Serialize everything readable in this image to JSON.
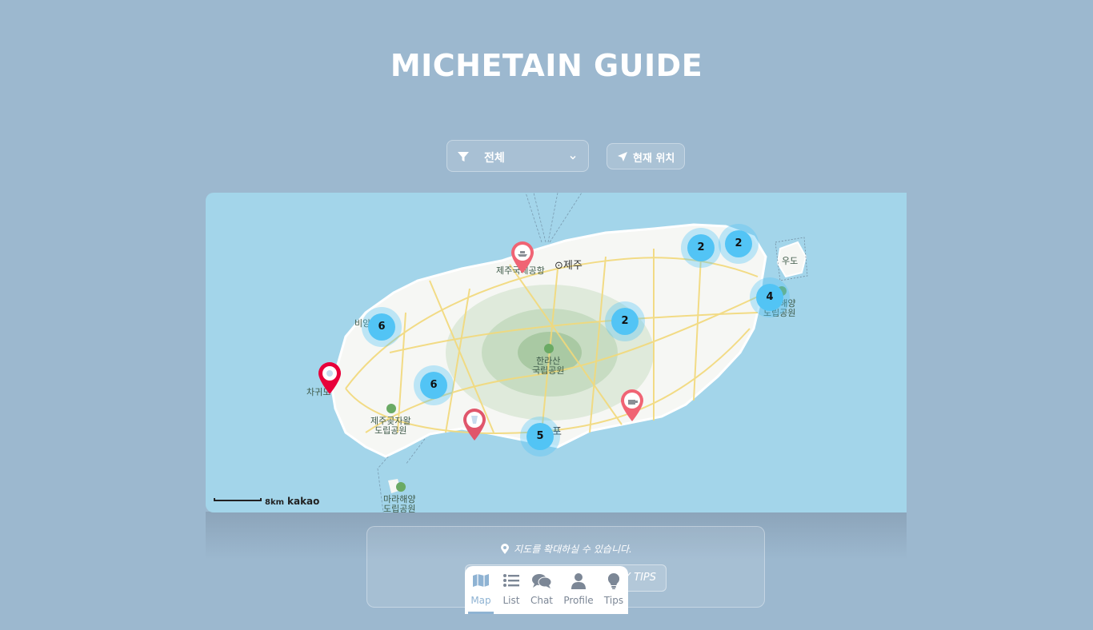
{
  "app": {
    "title": "MICHETAIN GUIDE"
  },
  "filter": {
    "selected": "전체"
  },
  "location_button": {
    "label": "현재 위치"
  },
  "map": {
    "places": {
      "airport": "제주국제공항",
      "jeju": "⊙제주",
      "udo": "우도",
      "marine_park": "한라해양\n도립공원",
      "hallasan": "한라산\n국립공원",
      "gotjawal": "제주곶자왈\n도립공원",
      "chagwido": "차귀도",
      "biyangdo": "비양",
      "seogwipo": "포",
      "marado": "마라해양\n도립공원"
    },
    "clusters": [
      "2",
      "2",
      "4",
      "6",
      "2",
      "6",
      "5"
    ],
    "scale_label": "8km",
    "provider": "kakao"
  },
  "info": {
    "hint": "지도를 확대하실 수 있습니다.",
    "tips_button": "MY TIPS"
  },
  "tabs": [
    {
      "label": "Map",
      "icon": "map-icon"
    },
    {
      "label": "List",
      "icon": "list-icon"
    },
    {
      "label": "Chat",
      "icon": "chat-icon"
    },
    {
      "label": "Profile",
      "icon": "profile-icon"
    },
    {
      "label": "Tips",
      "icon": "lightbulb-icon"
    }
  ],
  "colors": {
    "background": "#9cb8cf",
    "sea": "#a3d5ea",
    "cluster": "#52c4f5",
    "pin_red": "#e8003a",
    "pin_coral": "#f06474",
    "active_tab": "#8fb3d3"
  }
}
